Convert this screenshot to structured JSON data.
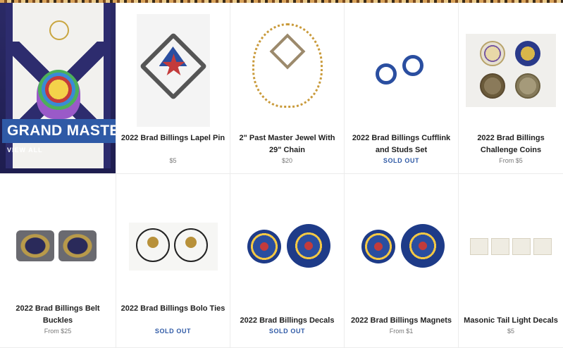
{
  "collection": {
    "title": "GRAND MASTER",
    "link_label": "VIEW ALL"
  },
  "products": [
    {
      "title": "2022 Brad Billings Lapel Pin",
      "price": "$5",
      "sold_out": false
    },
    {
      "title": "2\" Past Master Jewel With 29\" Chain",
      "price": "$20",
      "sold_out": false
    },
    {
      "title": "2022 Brad Billings Cufflink and Studs Set",
      "price": "SOLD OUT",
      "sold_out": true
    },
    {
      "title": "2022 Brad Billings Challenge Coins",
      "price": "From $5",
      "sold_out": false
    },
    {
      "title": "2022 Brad Billings Belt Buckles",
      "price": "From $25",
      "sold_out": false
    },
    {
      "title": "2022 Brad Billings Bolo Ties",
      "price": "SOLD OUT",
      "sold_out": true
    },
    {
      "title": "2022 Brad Billings Decals",
      "price": "SOLD OUT",
      "sold_out": true
    },
    {
      "title": "2022 Brad Billings Magnets",
      "price": "From $1",
      "sold_out": false
    },
    {
      "title": "Masonic Tail Light Decals",
      "price": "$5",
      "sold_out": false
    }
  ],
  "colors": {
    "accent": "#2f5aa6",
    "title_text": "#222222",
    "price_text": "#777777",
    "hero_bg": "#1e1d4f"
  }
}
